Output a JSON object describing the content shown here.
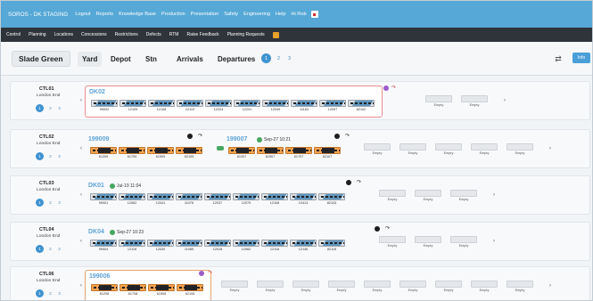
{
  "header": {
    "title": "SOROS - DK STAGING",
    "nav": [
      "Logout",
      "Reports",
      "Knowledge Base",
      "Production",
      "Presentation",
      "Safety",
      "Engineering",
      "Help"
    ],
    "user": "Hi Rob"
  },
  "menu": [
    "Control",
    "Planning",
    "Locations",
    "Concessions",
    "Restrictions",
    "Defects",
    "RTM",
    "Raise Feedback",
    "Planning Requests"
  ],
  "controls": {
    "location": "Slade Green",
    "views": [
      "Yard",
      "Depot",
      "Stn",
      "Arrivals",
      "Departures"
    ],
    "pages": [
      "1",
      "2",
      "3"
    ],
    "info": "Info"
  },
  "common": {
    "empty": "Empty",
    "arrow_left": "‹",
    "arrow_right": "›",
    "arrow_sym": "↷"
  },
  "tracks": [
    {
      "name": "CTL01",
      "sub": "London End",
      "consists": [
        {
          "id": "DK02",
          "status": "",
          "cars": [
            "99002",
            "12109",
            "12108",
            "12110",
            "12224",
            "12231",
            "12049",
            "11163",
            "12097",
            "82102"
          ]
        }
      ],
      "empties": 2
    },
    {
      "name": "CTL02",
      "sub": "London End",
      "consists": [
        {
          "id": "199009",
          "status": "",
          "cars": [
            "61209",
            "61709",
            "61909",
            "62109"
          ]
        },
        {
          "id": "199007",
          "status": "Sep-27 10:21",
          "cars": [
            "61207",
            "61907",
            "61707",
            "62107"
          ]
        }
      ],
      "empties": 5
    },
    {
      "name": "CTL03",
      "sub": "London End",
      "consists": [
        {
          "id": "DK01",
          "status": "Jul-19 11:04",
          "cars": [
            "99001",
            "12062",
            "12041",
            "11076",
            "12037",
            "12079",
            "12108",
            "10413",
            "82103"
          ]
        }
      ],
      "empties": 3
    },
    {
      "name": "CTL04",
      "sub": "London End",
      "consists": [
        {
          "id": "DK04",
          "status": "Sep-27 10:23",
          "cars": [
            "99004",
            "12118",
            "12030",
            "11089",
            "12018",
            "12062",
            "12116",
            "12146",
            "82118"
          ]
        }
      ],
      "empties": 3
    },
    {
      "name": "CTL06",
      "sub": "London End",
      "consists": [
        {
          "id": "199006",
          "status": "",
          "cars": [
            "61208",
            "61708",
            "61908",
            "62108"
          ]
        }
      ],
      "empties": 9
    }
  ]
}
